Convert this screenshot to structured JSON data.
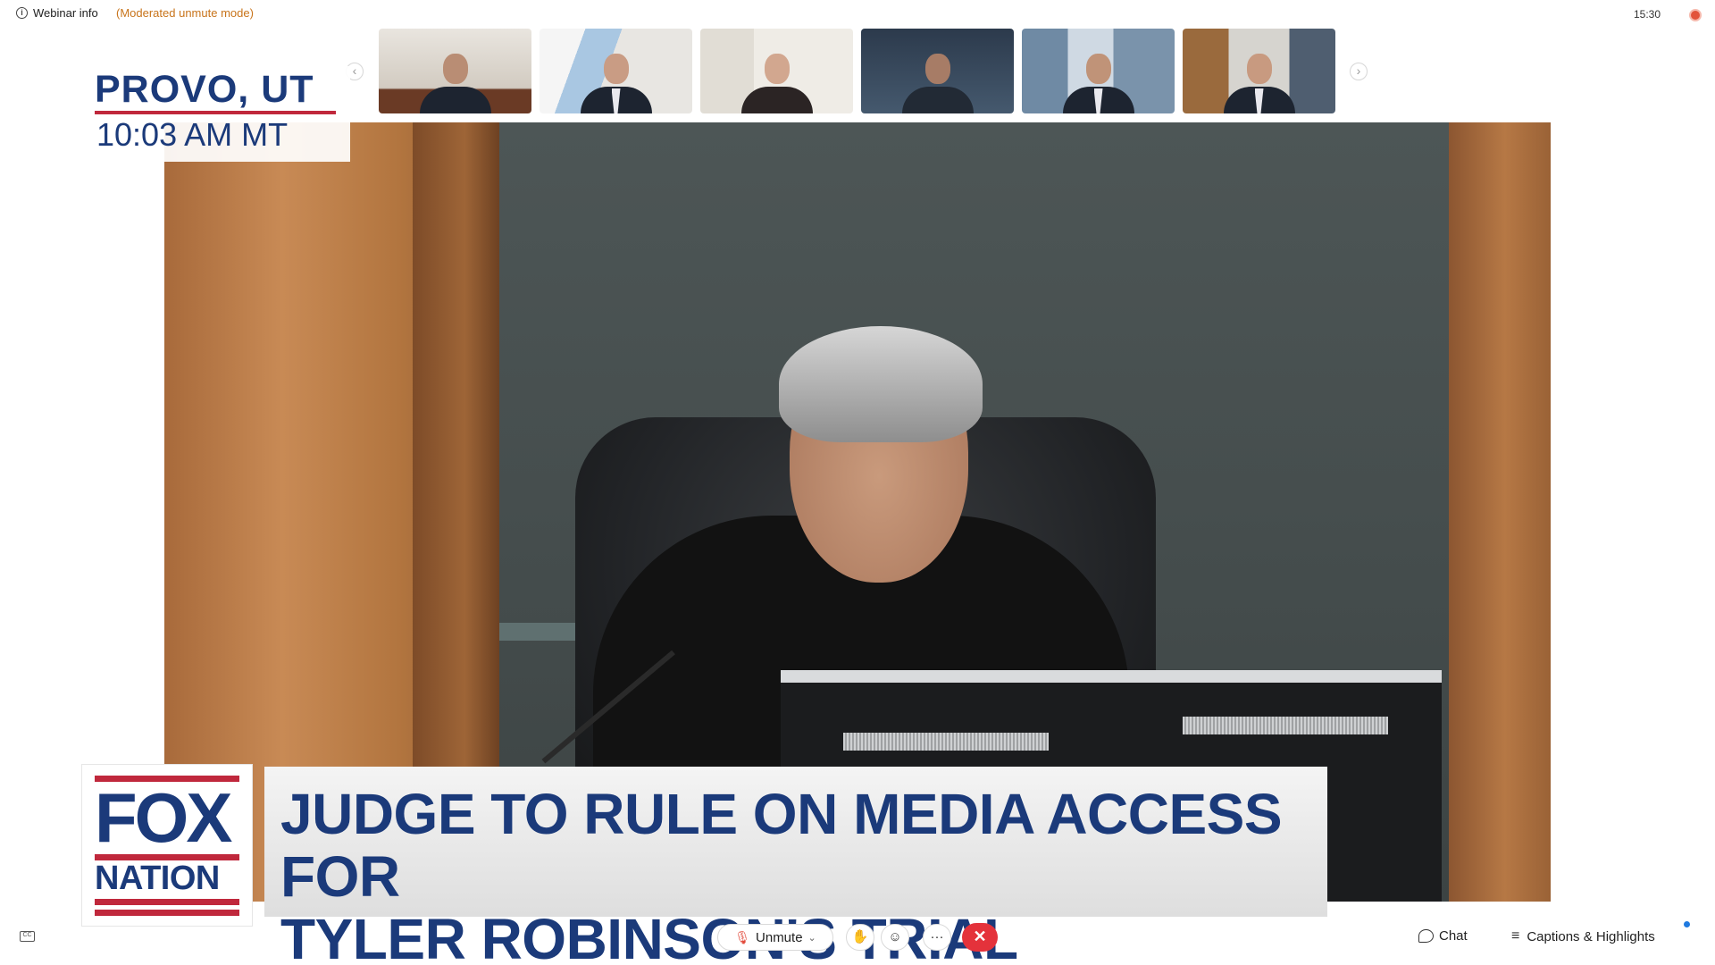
{
  "topbar": {
    "webinar_info": "Webinar info",
    "mode": "(Moderated unmute mode)",
    "clock": "15:30",
    "info_icon": "info-icon",
    "recording_icon": "recording-dot-icon"
  },
  "thumbnails": {
    "prev_icon": "chevron-left-icon",
    "next_icon": "chevron-right-icon",
    "prev_glyph": "‹",
    "next_glyph": "›",
    "count": 6
  },
  "location_bug": {
    "city": "PROVO, UT",
    "time": "10:03 AM  MT"
  },
  "lower_third": {
    "logo_top": "FOX",
    "logo_bottom": "NATION",
    "headline_line1": "JUDGE TO RULE ON MEDIA ACCESS FOR",
    "headline_line2": "TYLER ROBINSON'S TRIAL"
  },
  "toolbar": {
    "unmute_label": "Unmute",
    "mic_icon": "mic-off-icon",
    "raise_hand_icon": "raise-hand-icon",
    "reactions_icon": "emoji-icon",
    "more_label": "···",
    "leave_label": "✕",
    "chat_label": "Chat",
    "captions_label": "Captions & Highlights",
    "cc_label": "CC"
  },
  "colors": {
    "brand_blue": "#1b3a7a",
    "brand_red": "#c0283c",
    "leave_red": "#e4323b",
    "mode_orange": "#c8741b"
  }
}
